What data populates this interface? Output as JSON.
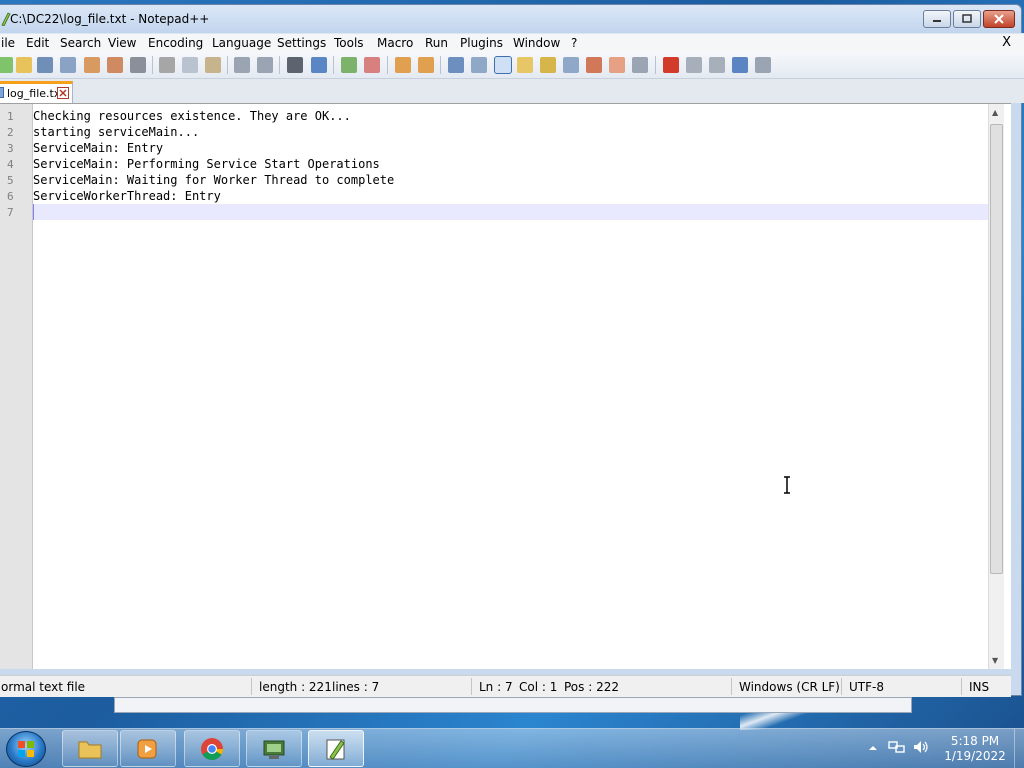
{
  "window": {
    "title": "C:\\DC22\\log_file.txt - Notepad++"
  },
  "menu": {
    "items": [
      "ile",
      "Edit",
      "Search",
      "View",
      "Encoding",
      "Language",
      "Settings",
      "Tools",
      "Macro",
      "Run",
      "Plugins",
      "Window",
      "?"
    ],
    "close_label": "X"
  },
  "tab": {
    "label": "log_file.txt"
  },
  "editor": {
    "line_numbers": [
      "1",
      "2",
      "3",
      "4",
      "5",
      "6",
      "7"
    ],
    "lines": [
      "Checking resources existence. They are OK...",
      "starting serviceMain...",
      "ServiceMain: Entry",
      "ServiceMain: Performing Service Start Operations",
      "ServiceMain: Waiting for Worker Thread to complete",
      "ServiceWorkerThread: Entry",
      ""
    ]
  },
  "statusbar": {
    "file_type": "ormal text file",
    "length": "length : 221",
    "lines": "lines : 7",
    "ln": "Ln : 7",
    "col": "Col : 1",
    "pos": "Pos : 222",
    "eol": "Windows (CR LF)",
    "encoding": "UTF-8",
    "mode": "INS"
  },
  "taskbar": {
    "time": "5:18 PM",
    "date": "1/19/2022"
  },
  "colors": {
    "tab_accent": "#f6a01a",
    "current_line": "#e8e8ff",
    "close_button": "#c1432a"
  }
}
